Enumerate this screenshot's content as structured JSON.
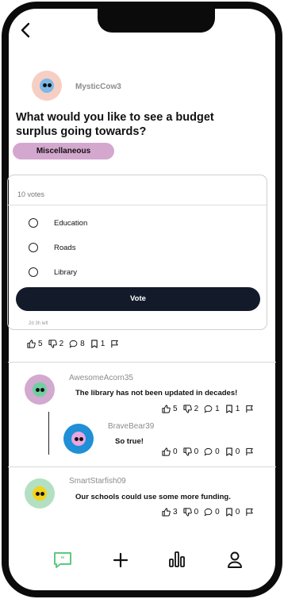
{
  "post": {
    "author": "MysticCow3",
    "question": "What would you like to see a budget surplus going towards?",
    "category": "Miscellaneous",
    "votes_label": "10 votes",
    "options": [
      "Education",
      "Roads",
      "Library"
    ],
    "vote_button": "Vote",
    "time_left": "2d 3h left",
    "stats": {
      "likes": "5",
      "dislikes": "2",
      "comments": "8",
      "saves": "1"
    }
  },
  "comments": [
    {
      "author": "AwesomeAcorn35",
      "text": "The library has not been updated in decades!",
      "stats": {
        "likes": "5",
        "dislikes": "2",
        "comments": "1",
        "saves": "1"
      },
      "replies": [
        {
          "author": "BraveBear39",
          "text": "So true!",
          "stats": {
            "likes": "0",
            "dislikes": "0",
            "comments": "0",
            "saves": "0"
          }
        }
      ]
    },
    {
      "author": "SmartStarfish09",
      "text": "Our schools could use some more funding.",
      "stats": {
        "likes": "3",
        "dislikes": "0",
        "comments": "0",
        "saves": "0"
      }
    }
  ],
  "nav": {
    "items": [
      {
        "icon": "quote-bubble-icon",
        "active": true
      },
      {
        "icon": "plus-icon",
        "active": false
      },
      {
        "icon": "bar-chart-icon",
        "active": false
      },
      {
        "icon": "profile-icon",
        "active": false
      }
    ]
  },
  "colors": {
    "accent": "#5ec97e",
    "vote_button": "#131b2b",
    "category_pill": "#d4a7cf",
    "avatar_post": "#f6cfc4",
    "avatar_acorn": "#d2a9cf",
    "avatar_bear": "#1f8fd6",
    "avatar_starfish": "#b4e0c2"
  }
}
